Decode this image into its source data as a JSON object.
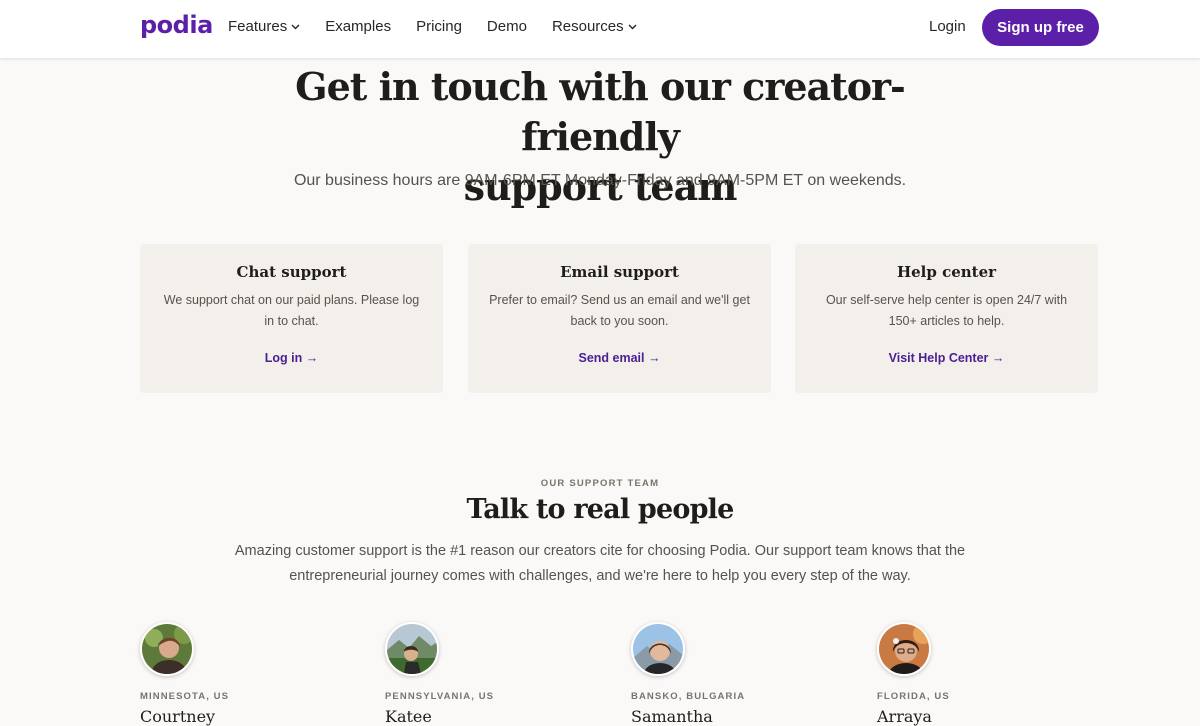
{
  "nav": {
    "logo": "podia",
    "links": [
      {
        "label": "Features",
        "has_dropdown": true
      },
      {
        "label": "Examples",
        "has_dropdown": false
      },
      {
        "label": "Pricing",
        "has_dropdown": false
      },
      {
        "label": "Demo",
        "has_dropdown": false
      },
      {
        "label": "Resources",
        "has_dropdown": true
      }
    ],
    "login": "Login",
    "signup": "Sign up free"
  },
  "hero": {
    "title_line1": "Get in touch with our creator-friendly",
    "title_line2": "support team",
    "subtitle": "Our business hours are 9AM-6PM ET Monday-Friday and 9AM-5PM ET on weekends."
  },
  "cards": [
    {
      "title": "Chat support",
      "description": "We support chat on our paid plans. Please log in to chat.",
      "link": "Log in →"
    },
    {
      "title": "Email support",
      "description": "Prefer to email? Send us an email and we'll get back to you soon.",
      "link": "Send email →"
    },
    {
      "title": "Help center",
      "description": "Our self-serve help center is open 24/7 with 150+ articles to help.",
      "link": "Visit Help Center →"
    }
  ],
  "team": {
    "eyebrow": "OUR SUPPORT TEAM",
    "title": "Talk to real people",
    "description": "Amazing customer support is the #1 reason our creators cite for choosing Podia. Our support team knows that the entrepreneurial journey comes with challenges, and we're here to help you every step of the way.",
    "members": [
      {
        "location": "MINNESOTA, US",
        "name": "Courtney"
      },
      {
        "location": "PENNSYLVANIA, US",
        "name": "Katee"
      },
      {
        "location": "BANSKO, BULGARIA",
        "name": "Samantha"
      },
      {
        "location": "FLORIDA, US",
        "name": "Arraya"
      }
    ]
  },
  "colors": {
    "brand": "#5b1fa8",
    "link": "#4a1f92",
    "page_bg": "#faf9f7",
    "card_bg": "#f3efeb"
  }
}
